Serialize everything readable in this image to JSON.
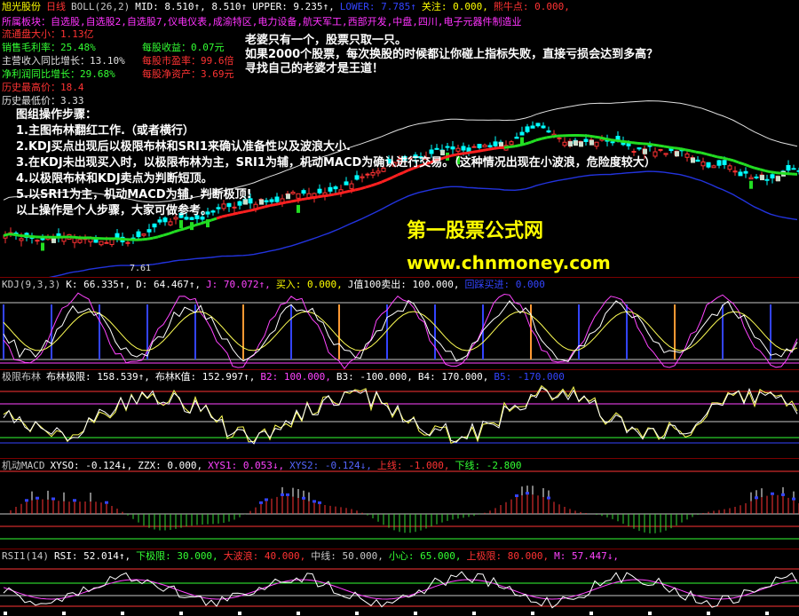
{
  "colors": {
    "bg": "#000000",
    "grid": "#7a0000",
    "up": "#ff3333",
    "down": "#00ffff",
    "ma_red": "#ff2020",
    "ma_green": "#22dd22",
    "band": "#e0e0e0",
    "lower": "#2233dd"
  },
  "main_panel": {
    "stock": "旭光股份",
    "period": "日线",
    "boll": "BOLL(26,2)",
    "mid": "MID: 8.510↑, 8.510↑",
    "upper": "UPPER: 9.235↑,",
    "lower_hidden": "LOWER: 7.785↑",
    "guanzhu": "关注: 0.000,",
    "niushi": "熊牛点: 0.000,",
    "sector_label": "所属板块：",
    "sector_value": "自选股,自选股2,自选股7,仪电仪表,成渝特区,电力设备,航天军工,西部开发,中盘,四川,电子元器件制造业",
    "float_cap": "流通盘大小：1.13亿",
    "gross_margin": "销售毛利率：25.48%",
    "eps": "每股收益：0.07元",
    "rev_growth": "主营收入同比增长：13.10%",
    "pe": "每股市盈率：99.6倍",
    "profit_growth": "净利润同比增长：29.68%",
    "bvps": "每股净资产：3.69元",
    "hist_high": "历史最高价：18.4",
    "hist_low": "历史最低价：3.33",
    "notice": [
      "老婆只有一个，股票只取一只。",
      "如果2000个股票，每次换股的时候都让你碰上指标失败，直接亏损会达到多高？",
      "寻找自己的老婆才是王道！"
    ],
    "steps_title": "图组操作步骤：",
    "steps": [
      "1.主图布林翻红工作.（或者横行）",
      "2.KDJ买点出现后以极限布林和SRI1来确认准备性以及波浪大小.",
      "3.在KDJ未出现买入时，以极限布林为主，SRI1为辅，机动MACD为确认进行交易。（这种情况出现在小波浪，危险度较大）",
      "4.以极限布林和KDJ卖点为判断短顶。",
      "5.以SRI1为主，机动MACD为辅，判断极顶!",
      "以上操作是个人步骤，大家可做参考。"
    ],
    "low_marker": "7.61",
    "watermark_name": "第一股票公式网",
    "watermark_url": "www.chnmoney.com"
  },
  "kdj_panel": {
    "title": "KDJ(9,3,3)",
    "k": "K: 66.335↑,",
    "d": "D: 64.467↑,",
    "j": "J: 70.072↑,",
    "buy": "买入: 0.000,",
    "j100": "J值100卖出: 100.000,",
    "extra": "回踩买进: 0.000"
  },
  "boll_limit_panel": {
    "title": "极限布林",
    "lim": "布林极限: 158.539↑,",
    "kval": "布林K值: 152.997↑,",
    "b2": "B2: 100.000,",
    "b3": "B3: -100.000,",
    "b4": "B4: 170.000,",
    "b5": "B5: -170.000"
  },
  "macd_panel": {
    "title": "机动MACD",
    "xyso": "XYSO: -0.124↓,",
    "zzx": "ZZX: 0.000,",
    "xys1": "XYS1: 0.053↓,",
    "xys2": "XYS2: -0.124↓,",
    "up": "上线: -1.000,",
    "down": "下线: -2.800"
  },
  "rsi_panel": {
    "title": "RSI1(14)",
    "rsi": "RSI: 52.014↑,",
    "low": "下极限: 30.000,",
    "big": "大波浪: 40.000,",
    "mid": "中线: 50.000,",
    "careful": "小心: 65.000,",
    "upper": "上极限: 80.000,",
    "m": "M: 57.447↓,"
  }
}
